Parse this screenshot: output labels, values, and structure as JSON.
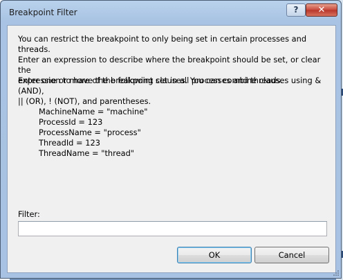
{
  "window": {
    "title": "Breakpoint Filter",
    "help_glyph": "?",
    "close_glyph": "✕"
  },
  "background": {
    "frag1": ")",
    "frag2": "o",
    "frag3": "o"
  },
  "content": {
    "description": "You can restrict the breakpoint to only being set in certain processes and threads.\nEnter an expression to describe where the breakpoint should be set, or clear the\nexpression to have the breakpoint set in all processes and threads.",
    "clauses_intro": "Enter one or more of the following clauses. You can combine clauses using & (AND),\n|| (OR), ! (NOT), and parentheses.",
    "clauses": [
      "MachineName = \"machine\"",
      "ProcessId = 123",
      "ProcessName = \"process\"",
      "ThreadId = 123",
      "ThreadName = \"thread\""
    ]
  },
  "filter": {
    "label": "Filter:",
    "value": "",
    "placeholder": ""
  },
  "buttons": {
    "ok": "OK",
    "cancel": "Cancel"
  }
}
